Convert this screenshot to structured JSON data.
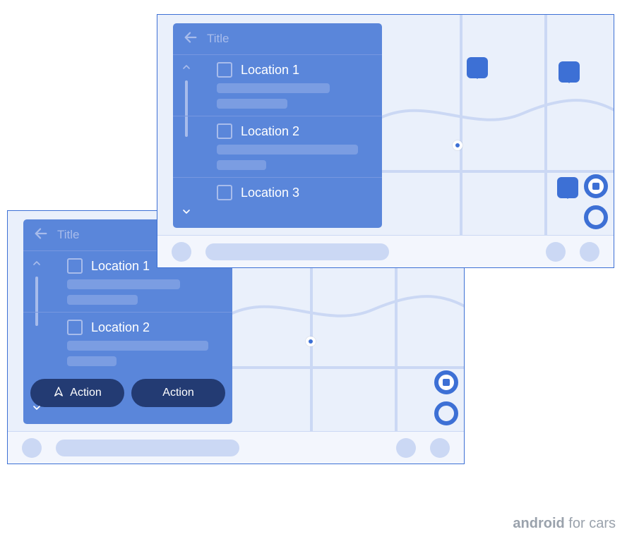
{
  "mock_a": {
    "panel_title": "Title",
    "items": [
      {
        "label": "Location 1"
      },
      {
        "label": "Location 2"
      },
      {
        "label": "Location 3"
      }
    ]
  },
  "mock_b": {
    "panel_title": "Title",
    "items": [
      {
        "label": "Location 1"
      },
      {
        "label": "Location 2"
      }
    ],
    "actions": [
      {
        "label": "Action"
      },
      {
        "label": "Action"
      }
    ]
  },
  "footer": {
    "brand": "android",
    "suffix": " for cars"
  }
}
